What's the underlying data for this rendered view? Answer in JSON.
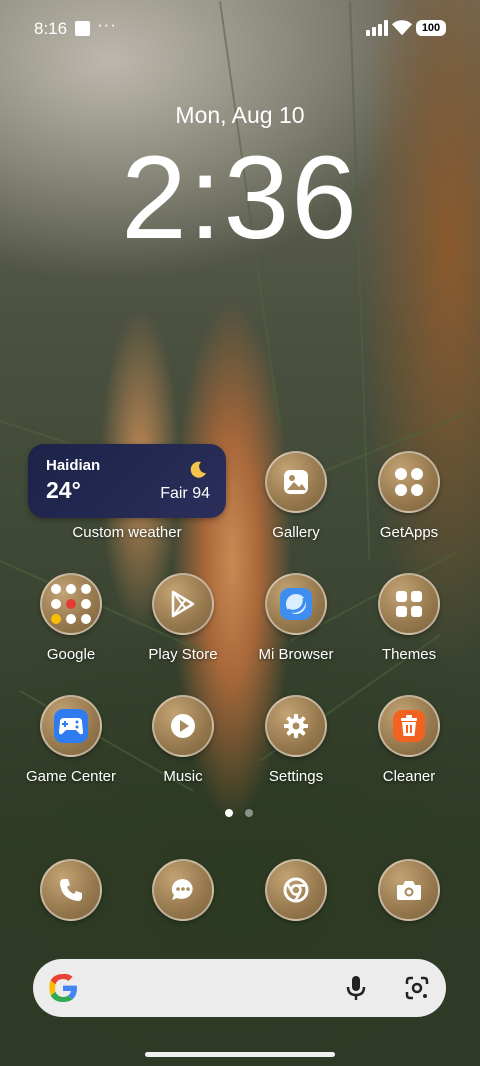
{
  "status_bar": {
    "time": "8:16",
    "more": "···",
    "battery": "100"
  },
  "lockscreen": {
    "date": "Mon, Aug 10",
    "time": "2:36"
  },
  "weather_widget": {
    "city": "Haidian",
    "temperature": "24°",
    "condition": "Fair 94",
    "label": "Custom weather"
  },
  "apps": {
    "gallery": "Gallery",
    "getapps": "GetApps",
    "google": "Google",
    "play_store": "Play Store",
    "mi_browser": "Mi Browser",
    "themes": "Themes",
    "game_center": "Game Center",
    "music": "Music",
    "settings": "Settings",
    "cleaner": "Cleaner"
  },
  "dock": [
    "phone-icon",
    "messages-icon",
    "chrome-icon",
    "camera-icon"
  ],
  "page_indicator": {
    "pages": 2,
    "current": 1
  },
  "colors": {
    "icon_bg": "#a88a5c",
    "weather_bg": "#1f2550",
    "cleaner_accent": "#f26322",
    "browser_accent": "#3d8ef0",
    "game_accent": "#2f7cf0"
  }
}
